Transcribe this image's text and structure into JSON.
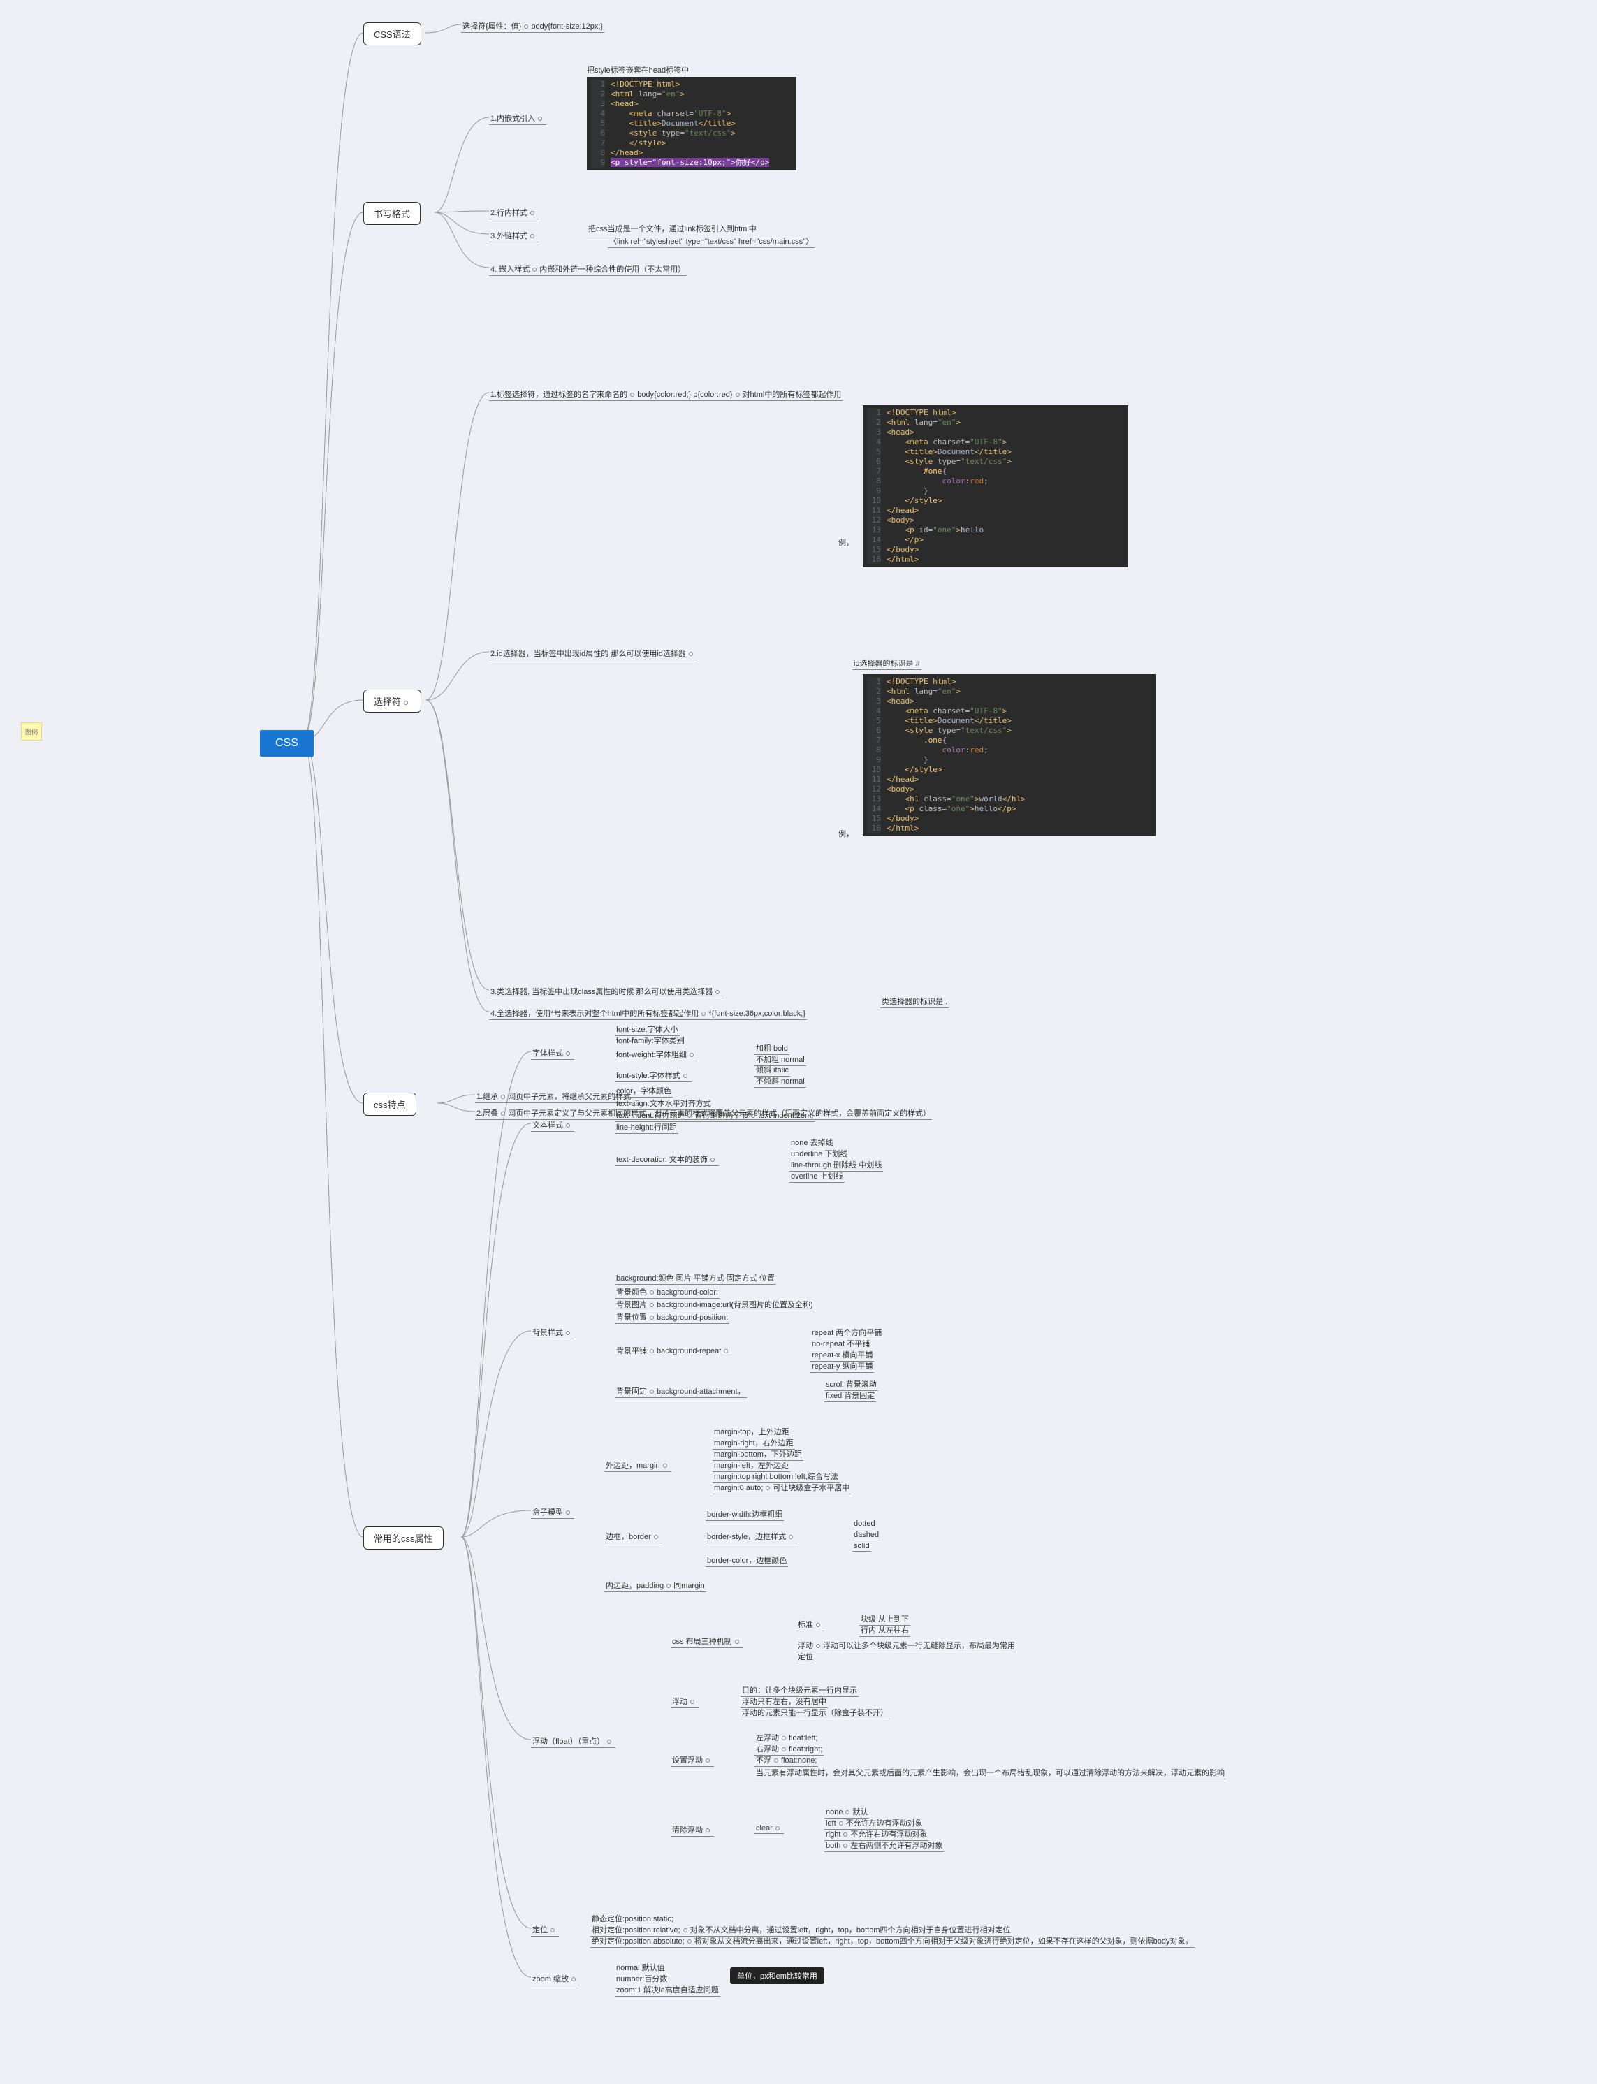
{
  "root": "CSS",
  "sticky": "图例",
  "tip": "单位，px和em比较常用",
  "syntax": {
    "title": "CSS语法",
    "rule": "选择符{属性：值}",
    "example": "body{font-size:12px;}"
  },
  "format": {
    "title": "书写格式",
    "inline": {
      "label": "1.内嵌式引入",
      "note": "把style标签嵌套在head标签中"
    },
    "row": "2.行内样式",
    "ext": {
      "label": "3.外链样式",
      "note1": "把css当成是一个文件，通过link标签引入到html中",
      "note2": "〈link rel=\"stylesheet\" type=\"text/css\" href=\"css/main.css\"〉"
    },
    "embed": {
      "label": "4. 嵌入样式",
      "note": "内嵌和外链一种综合性的使用（不太常用）"
    }
  },
  "select": {
    "title": "选择符",
    "tag": {
      "label": "1.标签选择符，通过标签的名字来命名的",
      "ex": "body{color:red;} p{color:red}",
      "suffix": "对html中的所有标签都起作用"
    },
    "id": {
      "label": "2.id选择器，当标签中出现id属性的 那么可以使用id选择器",
      "note": "id选择器的标识是 #",
      "eg": "例，"
    },
    "cls": {
      "label": "3.类选择器, 当标签中出现class属性的时候 那么可以使用类选择器",
      "note": "类选择器的标识是 .",
      "eg": "例，"
    },
    "all": {
      "label": "4.全选择器，使用*号来表示对整个html中的所有标签都起作用",
      "ex": "*{font-size:36px;color:black;}"
    }
  },
  "feature": {
    "title": "css特点",
    "inherit": {
      "label": "1.继承",
      "note": "网页中子元素，将继承父元素的样式"
    },
    "overlap": {
      "label": "2.层叠",
      "note": "网页中子元素定义了与父元素相同的样式，则子元素的样式将覆盖父元素的样式（后面定义的样式，会覆盖前面定义的样式）"
    }
  },
  "attrs": {
    "title": "常用的css属性",
    "font": {
      "title": "字体样式",
      "size": "font-size:字体大小",
      "family": "font-family:字体类别",
      "weight": {
        "label": "font-weight:字体粗细",
        "bold": "加粗 bold",
        "normal": "不加粗 normal"
      },
      "style": {
        "label": "font-style:字体样式",
        "italic": "倾斜 italic",
        "normal": "不倾斜 normal"
      },
      "color": "color，字体颜色"
    },
    "text": {
      "title": "文本样式",
      "align": "text-align:文本水平对齐方式",
      "indent": {
        "label": "text-indent:首行缩进",
        "note": "首行缩进两字节",
        "ex": "text-indent:2em;"
      },
      "lh": "line-height:行间距",
      "deco": {
        "label": "text-decoration 文本的装饰",
        "none": "none 去掉线",
        "under": "underline 下划线",
        "through": "line-through 删除线 中划线",
        "over": "overline 上划线"
      }
    },
    "bg": {
      "title": "背景样式",
      "all": "background:颜色 图片 平铺方式 固定方式 位置",
      "color": {
        "label": "背景颜色",
        "val": "background-color:"
      },
      "img": {
        "label": "背景图片",
        "val": "background-image:url(背景图片的位置及全称)"
      },
      "pos": {
        "label": "背景位置",
        "val": "background-position:"
      },
      "repeat": {
        "label": "背景平铺",
        "val": "background-repeat",
        "r1": "repeat 两个方向平铺",
        "r2": "no-repeat 不平铺",
        "r3": "repeat-x 横向平铺",
        "r4": "repeat-y 纵向平铺"
      },
      "attach": {
        "label": "背景固定",
        "val": "background-attachment，",
        "s1": "scroll 背景滚动",
        "s2": "fixed 背景固定"
      }
    },
    "box": {
      "title": "盒子模型",
      "margin": {
        "label": "外边距，margin",
        "top": "margin-top，上外边距",
        "right": "margin-right，右外边距",
        "bottom": "margin-bottom，下外边距",
        "left": "margin-left，左外边距",
        "short": "margin:top right bottom left;综合写法",
        "auto": "margin:0 auto;",
        "autoN": "可让块级盒子水平居中"
      },
      "border": {
        "label": "边框，border",
        "width": "border-width:边框粗细",
        "style": "border-style，边框样式",
        "s1": "dotted",
        "s2": "dashed",
        "s3": "solid",
        "color": "border-color，边框颜色"
      },
      "padding": {
        "label": "内边距，padding",
        "note": "同margin"
      }
    },
    "float": {
      "title": "浮动（float）（重点）",
      "layout": {
        "label": "css 布局三种机制",
        "std": "标准",
        "std1": "块级 从上到下",
        "std2": "行内 从左往右",
        "flt": "浮动",
        "fltN": "浮动可以让多个块级元素一行无缝隙显示，布局最为常用",
        "pos": "定位"
      },
      "flt": {
        "label": "浮动",
        "a": "目的：让多个块级元素一行内显示",
        "b": "浮动只有左右，没有居中",
        "c": "浮动的元素只能一行显示（除盒子装不开）"
      },
      "set": {
        "label": "设置浮动",
        "l": "左浮动",
        "lV": "float:left;",
        "r": "右浮动",
        "rV": "float:right;",
        "n": "不浮",
        "nV": "float:none;",
        "note": "当元素有浮动属性时，会对其父元素或后面的元素产生影响，会出现一个布局错乱现象，可以通过清除浮动的方法来解决，浮动元素的影响"
      },
      "clear": {
        "label": "清除浮动",
        "cl": "clear",
        "n": "none",
        "nN": "默认",
        "l": "left",
        "lN": "不允许左边有浮动对象",
        "r": "right",
        "rN": "不允许右边有浮动对象",
        "b": "both",
        "bN": "左右两侧不允许有浮动对象"
      }
    },
    "pos": {
      "title": "定位",
      "static": "静态定位:position:static;",
      "rel": {
        "label": "相对定位:position:relative;",
        "note": "对象不从文档中分离，通过设置left，right，top，bottom四个方向相对于自身位置进行相对定位"
      },
      "abs": {
        "label": "绝对定位:position:absolute;",
        "note": "将对象从文档流分离出来，通过设置left，right，top，bottom四个方向相对于父级对象进行绝对定位，如果不存在这样的父对象，则依据body对象。"
      }
    },
    "zoom": {
      "title": "zoom 缩放",
      "a": "normal 默认值",
      "b": "number:百分数",
      "c": "zoom:1 解决ie高度自适应问题"
    }
  },
  "chart_data": {
    "type": "tree",
    "root": "CSS",
    "children": [
      {
        "name": "CSS语法",
        "children": [
          {
            "name": "选择符{属性：值}",
            "children": [
              {
                "name": "body{font-size:12px;}"
              }
            ]
          }
        ]
      },
      {
        "name": "书写格式",
        "children": [
          {
            "name": "1.内嵌式引入",
            "note": "把style标签嵌套在head标签中"
          },
          {
            "name": "2.行内样式"
          },
          {
            "name": "3.外链样式",
            "note": "把css当成是一个文件，通过link标签引入到html中；〈link rel=\"stylesheet\" type=\"text/css\" href=\"css/main.css\"〉"
          },
          {
            "name": "4.嵌入样式",
            "note": "内嵌和外链一种综合性的使用（不太常用）"
          }
        ]
      },
      {
        "name": "选择符",
        "children": [
          {
            "name": "1.标签选择符",
            "example": "body{color:red;} p{color:red}",
            "note": "对html中的所有标签都起作用"
          },
          {
            "name": "2.id选择器",
            "note": "id选择器的标识是 #"
          },
          {
            "name": "3.类选择器",
            "note": "类选择器的标识是 ."
          },
          {
            "name": "4.全选择器",
            "example": "*{font-size:36px;color:black;}"
          }
        ]
      },
      {
        "name": "css特点",
        "children": [
          {
            "name": "1.继承",
            "note": "网页中子元素，将继承父元素的样式"
          },
          {
            "name": "2.层叠",
            "note": "网页中子元素定义了与父元素相同的样式，则子元素的样式将覆盖父元素的样式（后面定义的样式，会覆盖前面定义的样式）"
          }
        ]
      },
      {
        "name": "常用的css属性",
        "children": [
          {
            "name": "字体样式",
            "children": [
              {
                "name": "font-size:字体大小"
              },
              {
                "name": "font-family:字体类别"
              },
              {
                "name": "font-weight:字体粗细",
                "children": [
                  {
                    "name": "加粗 bold"
                  },
                  {
                    "name": "不加粗 normal"
                  }
                ]
              },
              {
                "name": "font-style:字体样式",
                "children": [
                  {
                    "name": "倾斜 italic"
                  },
                  {
                    "name": "不倾斜 normal"
                  }
                ]
              },
              {
                "name": "color，字体颜色"
              }
            ]
          },
          {
            "name": "文本样式",
            "children": [
              {
                "name": "text-align:文本水平对齐方式"
              },
              {
                "name": "text-indent:首行缩进",
                "children": [
                  {
                    "name": "首行缩进两字节"
                  },
                  {
                    "name": "text-indent:2em;"
                  }
                ]
              },
              {
                "name": "line-height:行间距"
              },
              {
                "name": "text-decoration 文本的装饰",
                "children": [
                  {
                    "name": "none 去掉线"
                  },
                  {
                    "name": "underline 下划线"
                  },
                  {
                    "name": "line-through 删除线 中划线"
                  },
                  {
                    "name": "overline 上划线"
                  }
                ]
              }
            ]
          },
          {
            "name": "背景样式",
            "children": [
              {
                "name": "background:颜色 图片 平铺方式 固定方式 位置"
              },
              {
                "name": "背景颜色 background-color:"
              },
              {
                "name": "背景图片 background-image:url(背景图片的位置及全称)"
              },
              {
                "name": "背景位置 background-position:"
              },
              {
                "name": "背景平铺 background-repeat",
                "children": [
                  {
                    "name": "repeat 两个方向平铺"
                  },
                  {
                    "name": "no-repeat 不平铺"
                  },
                  {
                    "name": "repeat-x 横向平铺"
                  },
                  {
                    "name": "repeat-y 纵向平铺"
                  }
                ]
              },
              {
                "name": "背景固定 background-attachment",
                "children": [
                  {
                    "name": "scroll 背景滚动"
                  },
                  {
                    "name": "fixed 背景固定"
                  }
                ]
              }
            ]
          },
          {
            "name": "盒子模型",
            "children": [
              {
                "name": "外边距，margin",
                "children": [
                  {
                    "name": "margin-top，上外边距"
                  },
                  {
                    "name": "margin-right，右外边距"
                  },
                  {
                    "name": "margin-bottom，下外边距"
                  },
                  {
                    "name": "margin-left，左外边距"
                  },
                  {
                    "name": "margin:top right bottom left;综合写法"
                  },
                  {
                    "name": "margin:0 auto;",
                    "note": "可让块级盒子水平居中"
                  }
                ]
              },
              {
                "name": "边框，border",
                "children": [
                  {
                    "name": "border-width:边框粗细"
                  },
                  {
                    "name": "border-style，边框样式",
                    "children": [
                      {
                        "name": "dotted"
                      },
                      {
                        "name": "dashed"
                      },
                      {
                        "name": "solid"
                      }
                    ]
                  },
                  {
                    "name": "border-color，边框颜色"
                  }
                ]
              },
              {
                "name": "内边距，padding",
                "note": "同margin"
              }
            ]
          },
          {
            "name": "浮动（float）（重点）",
            "children": [
              {
                "name": "css 布局三种机制",
                "children": [
                  {
                    "name": "标准",
                    "children": [
                      {
                        "name": "块级 从上到下"
                      },
                      {
                        "name": "行内 从左往右"
                      }
                    ]
                  },
                  {
                    "name": "浮动",
                    "note": "浮动可以让多个块级元素一行无缝隙显示，布局最为常用"
                  },
                  {
                    "name": "定位"
                  }
                ]
              },
              {
                "name": "浮动",
                "children": [
                  {
                    "name": "目的：让多个块级元素一行内显示"
                  },
                  {
                    "name": "浮动只有左右，没有居中"
                  },
                  {
                    "name": "浮动的元素只能一行显示（除盒子装不开）"
                  }
                ]
              },
              {
                "name": "设置浮动",
                "children": [
                  {
                    "name": "左浮动 float:left;"
                  },
                  {
                    "name": "右浮动 float:right;"
                  },
                  {
                    "name": "不浮 float:none;"
                  },
                  {
                    "name": "当元素有浮动属性时，会对其父元素或后面的元素产生影响，会出现一个布局错乱现象，可以通过清除浮动的方法来解决，浮动元素的影响"
                  }
                ]
              },
              {
                "name": "清除浮动 clear",
                "children": [
                  {
                    "name": "none 默认"
                  },
                  {
                    "name": "left 不允许左边有浮动对象"
                  },
                  {
                    "name": "right 不允许右边有浮动对象"
                  },
                  {
                    "name": "both 左右两侧不允许有浮动对象"
                  }
                ]
              }
            ]
          },
          {
            "name": "定位",
            "children": [
              {
                "name": "静态定位:position:static;"
              },
              {
                "name": "相对定位:position:relative;",
                "note": "对象不从文档中分离，通过设置left，right，top，bottom四个方向相对于自身位置进行相对定位"
              },
              {
                "name": "绝对定位:position:absolute;",
                "note": "将对象从文档流分离出来，通过设置left，right，top，bottom四个方向相对于父级对象进行绝对定位，如果不存在这样的父对象，则依据body对象。"
              }
            ]
          },
          {
            "name": "zoom 缩放",
            "children": [
              {
                "name": "normal 默认值"
              },
              {
                "name": "number:百分数"
              },
              {
                "name": "zoom:1 解决ie高度自适应问题"
              }
            ]
          }
        ]
      }
    ]
  }
}
